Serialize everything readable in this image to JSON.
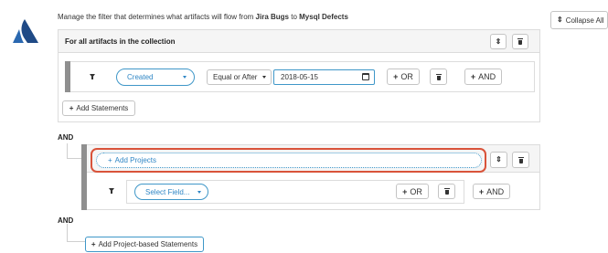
{
  "header": {
    "description_prefix": "Manage the filter that determines what artifacts will flow from ",
    "source": "Jira Bugs",
    "connector": " to ",
    "target": "Mysql Defects"
  },
  "collapse_all_label": "Collapse All",
  "collection": {
    "title": "For all artifacts in the collection",
    "statement": {
      "field": "Created",
      "operator": "Equal or After",
      "date_value": "2018-05-15",
      "or_label": "OR",
      "and_label": "AND"
    },
    "add_statements_label": "Add Statements"
  },
  "and_label_1": "AND",
  "project_group": {
    "add_projects_label": "Add Projects",
    "statement": {
      "field_placeholder": "Select Field...",
      "or_label": "OR",
      "and_label": "AND"
    }
  },
  "and_label_2": "AND",
  "add_project_based_label": "Add Project-based Statements",
  "colors": {
    "brand": "#1f4a86",
    "accent": "#3f97c8",
    "highlight": "#d9533a"
  }
}
